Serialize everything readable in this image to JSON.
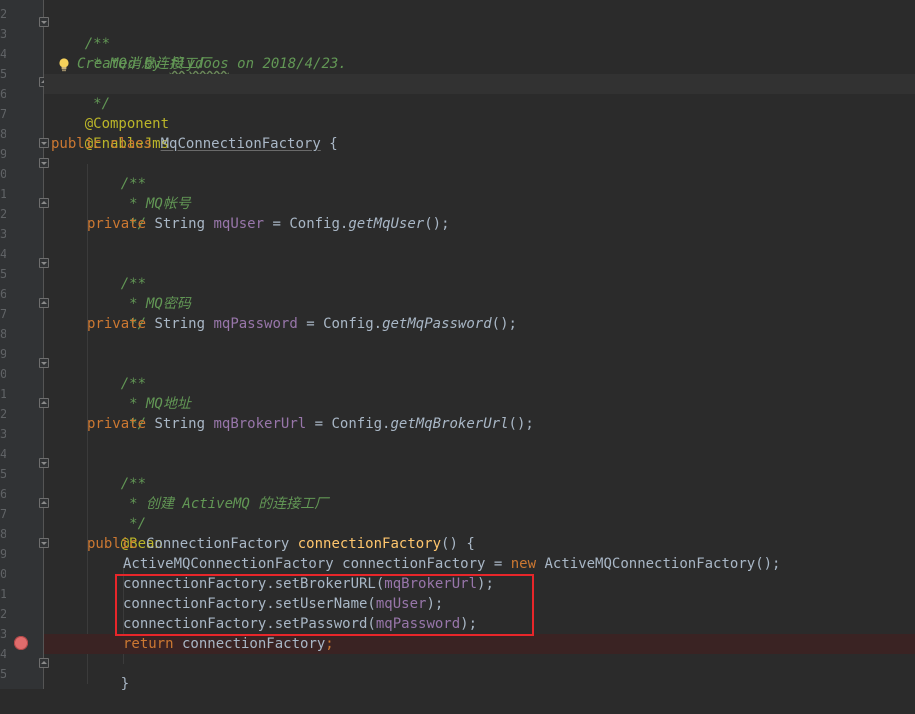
{
  "gutter": {
    "line_numbers": [
      "2",
      "3",
      "4",
      "5",
      "6",
      "7",
      "8",
      "9",
      "0",
      "1",
      "2",
      "3",
      "4",
      "5",
      "6",
      "7",
      "8",
      "9",
      "0",
      "1",
      "2",
      "3",
      "4",
      "5",
      "6",
      "7",
      "8",
      "9",
      "0",
      "1",
      "2",
      "3",
      "4",
      "5"
    ]
  },
  "code": {
    "doc_open": "/**",
    "doc_title": " * MQ消息连接工厂",
    "doc_created_prefix": "Created by ",
    "doc_author": "flydoos",
    "doc_created_suffix": " on 2018/4/23.",
    "doc_close": " */",
    "ann_component": "@Component",
    "ann_enable_jms": "@EnableJms",
    "kw_public": "public",
    "kw_class": "class",
    "class_name": "MqConnectionFactory",
    "brace_open": " {",
    "c_open": "/**",
    "c_close": " */",
    "c_user": " * MQ帐号",
    "c_password": " * MQ密码",
    "c_broker": " * MQ地址",
    "c_factory": " * 创建 ActiveMQ 的连接工厂",
    "kw_private": "private",
    "type_string": "String",
    "field_user": "mqUser",
    "field_password": "mqPassword",
    "field_broker": "mqBrokerUrl",
    "assign": " = ",
    "config": "Config.",
    "m_get_user": "getMqUser",
    "m_get_password": "getMqPassword",
    "m_get_broker": "getMqBrokerUrl",
    "call_end": "();",
    "ann_bean": "@Bean",
    "type_cf": "ConnectionFactory",
    "m_cf": "connectionFactory",
    "m_cf_sig_end": "() {",
    "type_amq": "ActiveMQConnectionFactory",
    "var_cf": "connectionFactory",
    "kw_new": "new",
    "ctor_amq": "ActiveMQConnectionFactory",
    "call_broker": "connectionFactory.setBrokerURL(",
    "call_username": "connectionFactory.setUserName(",
    "call_password": "connectionFactory.setPassword(",
    "paren_end": ");",
    "kw_return": "return",
    "return_val": " connectionFactory",
    "semicolon": ";",
    "brace_close": "}"
  },
  "colors": {
    "background": "#2b2b2b",
    "keyword": "#cc7832",
    "comment": "#629755",
    "annotation": "#bbb529",
    "field": "#9876aa",
    "method": "#ffc66d",
    "text": "#a9b7c6",
    "highlight_box": "#e8262a",
    "breakpoint": "#e06c6c"
  },
  "icons": {
    "bulb": "lightbulb-icon",
    "breakpoint": "breakpoint-icon",
    "fold": "fold-icon"
  }
}
